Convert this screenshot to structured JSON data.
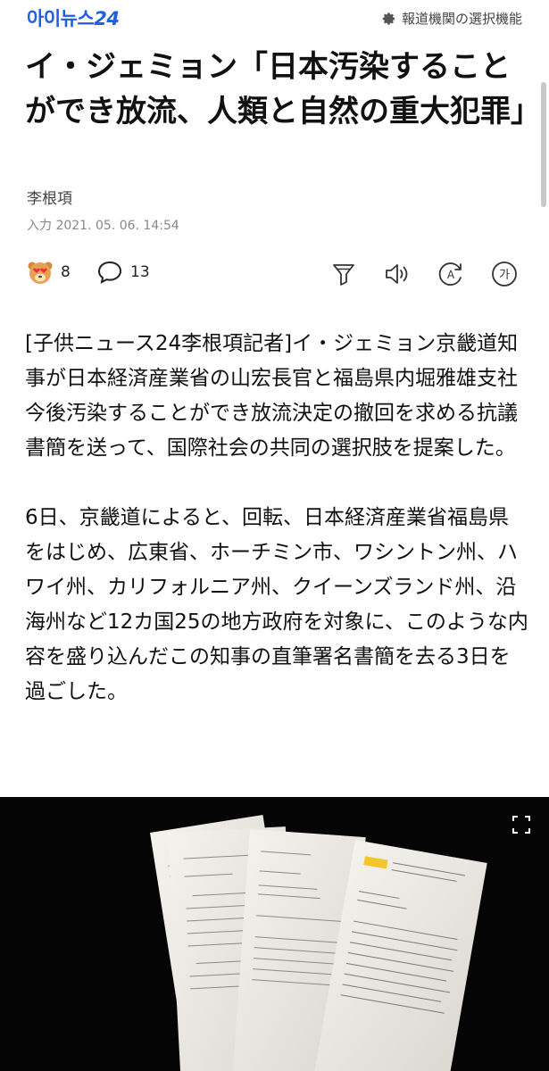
{
  "header": {
    "logo_text": "아이뉴스",
    "logo_number": "24",
    "press_label": "報道機関の選択機能"
  },
  "article": {
    "title": "イ・ジェミョン「日本汚染することができ放流、人類と自然の重大犯罪」",
    "author": "李根項",
    "date": "入力 2021. 05. 06. 14:54",
    "reaction_count": "8",
    "comment_count": "13",
    "paragraphs": [
      "[子供ニュース24李根項記者]イ・ジェミョン京畿道知事が日本経済産業省の山宏長官と福島県内堀雅雄支社今後汚染することができ放流決定の撤回を求める抗議書簡を送って、国際社会の共同の選択肢を提案した。",
      "6日、京畿道によると、回転、日本経済産業省福島県をはじめ、広東省、ホーチミン市、ワシントン州、ハワイ州、カリフォルニア州、クイーンズランド州、沿海州など12カ国25の地方政府を対象に、このような内容を盛り込んだこの知事の直筆署名書簡を去る3日を過ごした。"
    ]
  },
  "toolbar": {
    "icons": [
      "filter-icon",
      "audio-icon",
      "translate-icon",
      "font-size-icon"
    ],
    "font_size_glyph": "가",
    "translate_glyph": "A"
  },
  "photo": {
    "alt_icon": "expand-icon"
  }
}
